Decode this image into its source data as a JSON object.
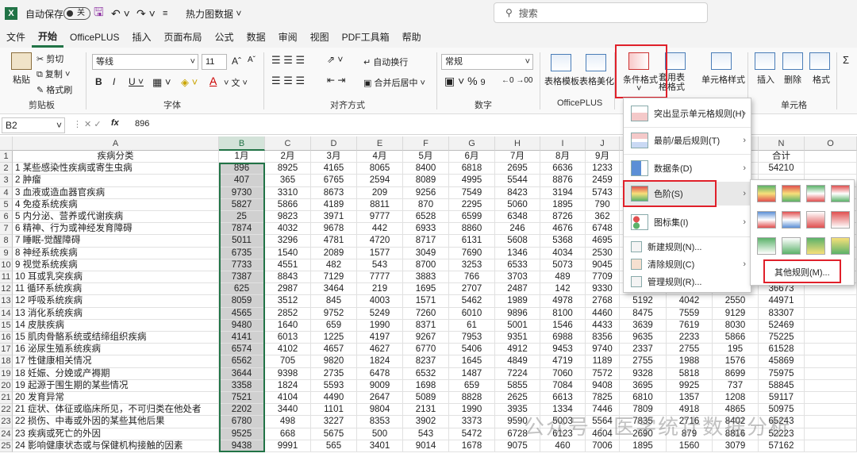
{
  "titlebar": {
    "autosave": "自动保存",
    "toggle": "关",
    "filename": "热力图数据",
    "search_placeholder": "搜索"
  },
  "menu": [
    "文件",
    "开始",
    "OfficePLUS",
    "插入",
    "页面布局",
    "公式",
    "数据",
    "审阅",
    "视图",
    "PDF工具箱",
    "帮助"
  ],
  "ribbon": {
    "clipboard": {
      "paste": "粘贴",
      "cut": "剪切",
      "copy": "复制",
      "format_painter": "格式刷",
      "label": "剪贴板"
    },
    "font": {
      "name": "等线",
      "size": "11",
      "label": "字体"
    },
    "align": {
      "wrap": "自动换行",
      "merge": "合并后居中",
      "label": "对齐方式"
    },
    "number": {
      "format": "常规",
      "label": "数字"
    },
    "officeplus": {
      "table_template": "表格模板",
      "table_beautify": "表格美化",
      "label": "OfficePLUS"
    },
    "styles": {
      "conditional": "条件格式",
      "as_table": "套用表格格式",
      "cell_style": "单元格样式"
    },
    "cells": {
      "insert": "插入",
      "delete": "删除",
      "format": "格式",
      "label": "单元格"
    }
  },
  "formula": {
    "namebox": "B2",
    "fx": "fx",
    "value": "896"
  },
  "columns": [
    "A",
    "B",
    "C",
    "D",
    "E",
    "F",
    "G",
    "H",
    "I",
    "J",
    "K",
    "L",
    "M",
    "N",
    "O"
  ],
  "header_row": [
    "疾病分类",
    "1月",
    "2月",
    "3月",
    "4月",
    "5月",
    "6月",
    "7月",
    "8月",
    "9月",
    "",
    "",
    "",
    "合计"
  ],
  "rows": [
    [
      "1 某些感染性疾病或寄生虫病",
      "896",
      "8925",
      "4165",
      "8065",
      "8400",
      "6818",
      "2695",
      "6636",
      "1233",
      "",
      "",
      "",
      "54210"
    ],
    [
      "2 肿瘤",
      "407",
      "365",
      "6765",
      "2594",
      "8089",
      "4995",
      "5544",
      "8876",
      "2459",
      "",
      "",
      "",
      ""
    ],
    [
      "3 血液或造血器官疾病",
      "9730",
      "3310",
      "8673",
      "209",
      "9256",
      "7549",
      "8423",
      "3194",
      "5743",
      "",
      "",
      "",
      ""
    ],
    [
      "4 免疫系统疾病",
      "5827",
      "5866",
      "4189",
      "8811",
      "870",
      "2295",
      "5060",
      "1895",
      "790",
      "",
      "",
      "",
      ""
    ],
    [
      "5 内分泌、营养或代谢疾病",
      "25",
      "9823",
      "3971",
      "9777",
      "6528",
      "6599",
      "6348",
      "8726",
      "362",
      "",
      "",
      "",
      ""
    ],
    [
      "6 精神、行为或神经发育障碍",
      "7874",
      "4032",
      "9678",
      "442",
      "6933",
      "8860",
      "246",
      "4676",
      "6748",
      "",
      "",
      "",
      ""
    ],
    [
      "7 睡眠-觉醒障碍",
      "5011",
      "3296",
      "4781",
      "4720",
      "8717",
      "6131",
      "5608",
      "5368",
      "4695",
      "",
      "",
      "",
      ""
    ],
    [
      "8 神经系统疾病",
      "6735",
      "1540",
      "2089",
      "1577",
      "3049",
      "7690",
      "1346",
      "4034",
      "2530",
      "",
      "",
      "",
      ""
    ],
    [
      "9 视觉系统疾病",
      "7733",
      "4551",
      "482",
      "543",
      "8700",
      "3253",
      "6533",
      "5073",
      "9045",
      "",
      "",
      "",
      ""
    ],
    [
      "10 耳或乳突疾病",
      "7387",
      "8843",
      "7129",
      "7777",
      "3883",
      "766",
      "3703",
      "489",
      "7709",
      "",
      "",
      "",
      ""
    ],
    [
      "11 循环系统疾病",
      "625",
      "2987",
      "3464",
      "219",
      "1695",
      "2707",
      "2487",
      "142",
      "9330",
      "323",
      "6533",
      "6161",
      "36673"
    ],
    [
      "12 呼吸系统疾病",
      "8059",
      "3512",
      "845",
      "4003",
      "1571",
      "5462",
      "1989",
      "4978",
      "2768",
      "5192",
      "4042",
      "2550",
      "44971"
    ],
    [
      "13 消化系统疾病",
      "4565",
      "2852",
      "9752",
      "5249",
      "7260",
      "6010",
      "9896",
      "8100",
      "4460",
      "8475",
      "7559",
      "9129",
      "83307"
    ],
    [
      "14 皮肤疾病",
      "9480",
      "1640",
      "659",
      "1990",
      "8371",
      "61",
      "5001",
      "1546",
      "4433",
      "3639",
      "7619",
      "8030",
      "52469"
    ],
    [
      "15 肌肉骨骼系统或结缔组织疾病",
      "4141",
      "6013",
      "1225",
      "4197",
      "9267",
      "7953",
      "9351",
      "6988",
      "8356",
      "9635",
      "2233",
      "5866",
      "75225"
    ],
    [
      "16 泌尿生殖系统疾病",
      "6574",
      "4102",
      "4657",
      "4627",
      "6770",
      "5406",
      "4912",
      "9453",
      "9740",
      "2337",
      "2755",
      "195",
      "61528"
    ],
    [
      "17 性健康相关情况",
      "6562",
      "705",
      "9820",
      "1824",
      "8237",
      "1645",
      "4849",
      "4719",
      "1189",
      "2755",
      "1988",
      "1576",
      "45869"
    ],
    [
      "18 妊娠、分娩或产褥期",
      "3644",
      "9398",
      "2735",
      "6478",
      "6532",
      "1487",
      "7224",
      "7060",
      "7572",
      "9328",
      "5818",
      "8699",
      "75975"
    ],
    [
      "19 起源于围生期的某些情况",
      "3358",
      "1824",
      "5593",
      "9009",
      "1698",
      "659",
      "5855",
      "7084",
      "9408",
      "3695",
      "9925",
      "737",
      "58845"
    ],
    [
      "20 发育异常",
      "7521",
      "4104",
      "4490",
      "2647",
      "5089",
      "8828",
      "2625",
      "6613",
      "7825",
      "6810",
      "1357",
      "1208",
      "59117"
    ],
    [
      "21 症状、体征或临床所见，不可归类在他处者",
      "2202",
      "3440",
      "1101",
      "9804",
      "2131",
      "1990",
      "3935",
      "1334",
      "7446",
      "7809",
      "4918",
      "4865",
      "50975"
    ],
    [
      "22 损伤、中毒或外因的某些其他后果",
      "6780",
      "498",
      "3227",
      "8353",
      "3902",
      "3373",
      "9590",
      "5003",
      "5564",
      "7835",
      "2716",
      "8402",
      "65243"
    ],
    [
      "23 疾病或死亡的外因",
      "9525",
      "668",
      "5675",
      "500",
      "543",
      "5472",
      "6728",
      "6123",
      "4604",
      "2690",
      "879",
      "8816",
      "52223"
    ],
    [
      "24 影响健康状态或与保健机构接触的因素",
      "9438",
      "9991",
      "565",
      "3401",
      "9014",
      "1678",
      "9075",
      "460",
      "7006",
      "1895",
      "1560",
      "3079",
      "57162"
    ]
  ],
  "dropdown": [
    "突出显示单元格规则(H)",
    "最前/最后规则(T)",
    "数据条(D)",
    "色阶(S)",
    "图标集(I)",
    "新建规则(N)...",
    "清除规则(C)",
    "管理规则(R)..."
  ],
  "submenu_more": "其他规则(M)...",
  "watermark": "公众号 · 医学统计数据分析",
  "colors": {
    "accent": "#217346",
    "red_box": "#e0202a"
  }
}
